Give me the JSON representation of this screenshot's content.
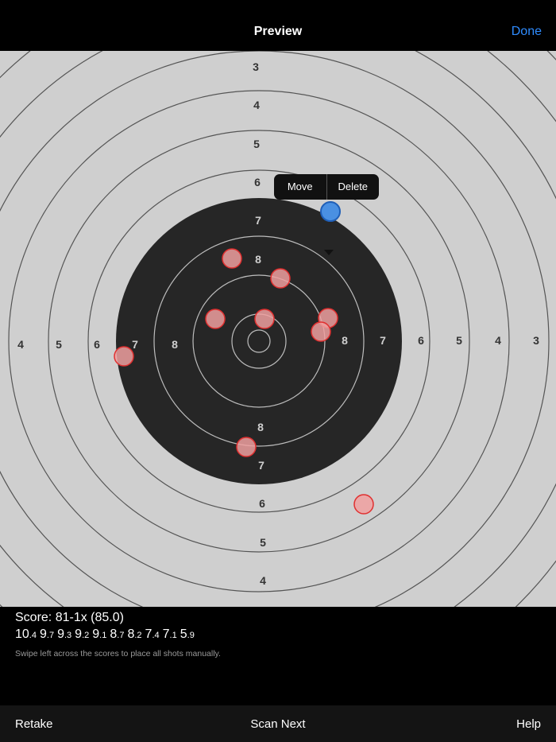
{
  "nav": {
    "title": "Preview",
    "done_label": "Done"
  },
  "target": {
    "ring_numbers": {
      "top": [
        "3",
        "4",
        "5",
        "6",
        "7",
        "8"
      ],
      "left": [
        "4",
        "5",
        "6",
        "7",
        "8"
      ],
      "right": [
        "8",
        "7",
        "6",
        "5",
        "4",
        "3"
      ],
      "bottom": [
        "8",
        "7",
        "6",
        "5",
        "4"
      ]
    },
    "selected_shot_color": "#4a90e2",
    "shot_color": "#f0a0a0",
    "shot_outline_color": "#e03030"
  },
  "popover": {
    "move_label": "Move",
    "delete_label": "Delete"
  },
  "score": {
    "summary": "Score: 81-1x (85.0)",
    "shots": [
      {
        "whole": "10",
        "dec": ".4"
      },
      {
        "whole": "9",
        "dec": ".7"
      },
      {
        "whole": "9",
        "dec": ".3"
      },
      {
        "whole": "9",
        "dec": ".2"
      },
      {
        "whole": "9",
        "dec": ".1"
      },
      {
        "whole": "8",
        "dec": ".7"
      },
      {
        "whole": "8",
        "dec": ".2"
      },
      {
        "whole": "7",
        "dec": ".4"
      },
      {
        "whole": "7",
        "dec": ".1"
      },
      {
        "whole": "5",
        "dec": ".9"
      }
    ],
    "hint": "Swipe left across the scores to place all shots manually."
  },
  "toolbar": {
    "retake_label": "Retake",
    "scan_next_label": "Scan Next",
    "help_label": "Help"
  }
}
